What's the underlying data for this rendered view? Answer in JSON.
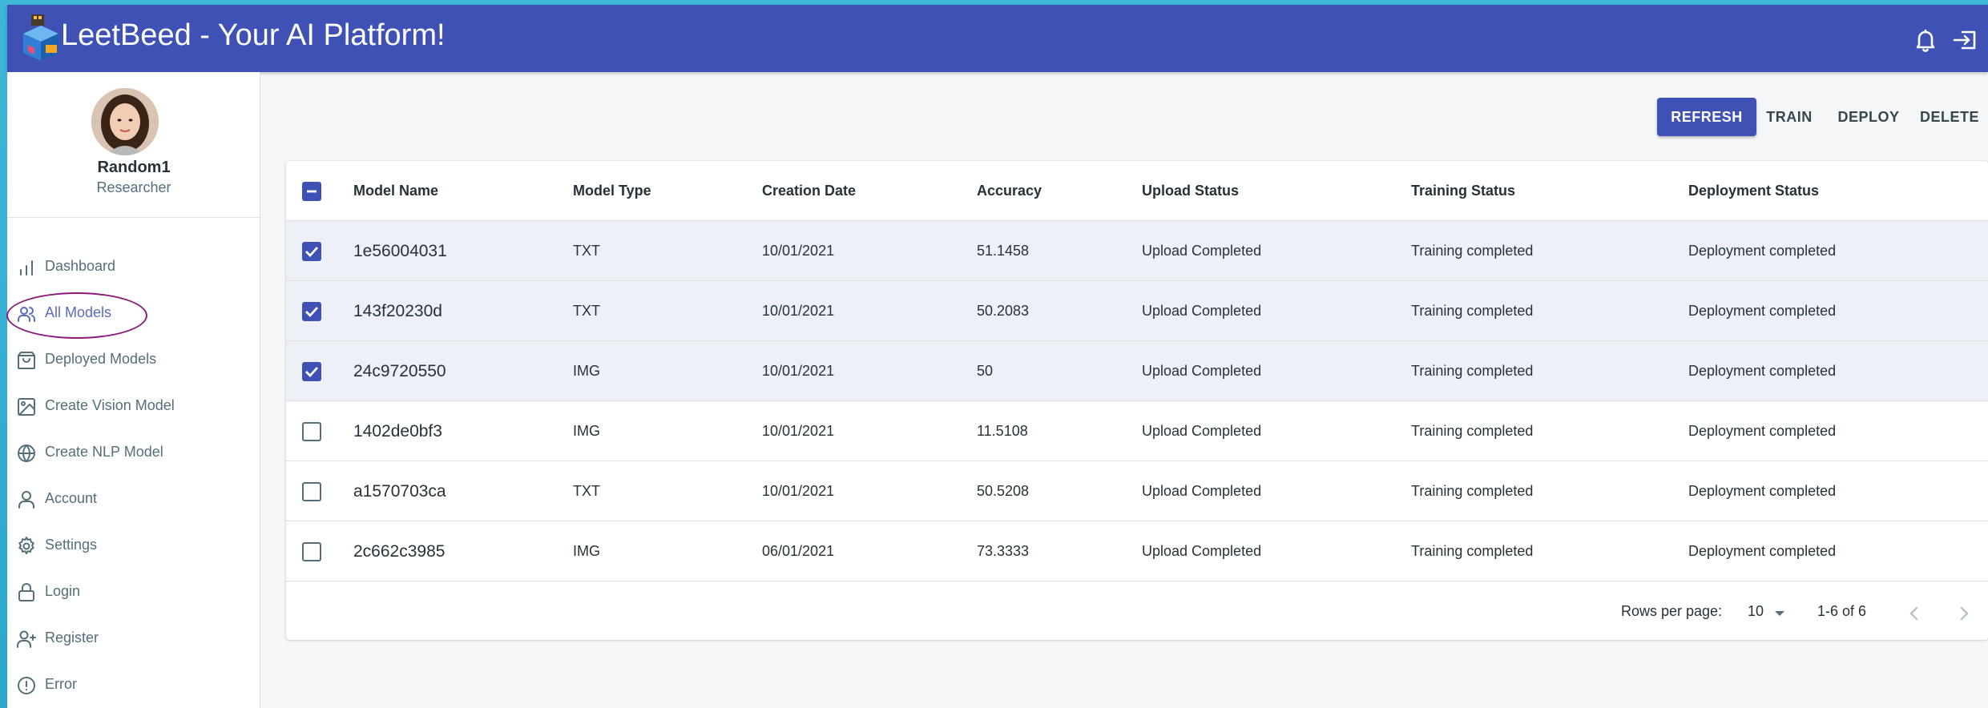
{
  "app": {
    "title": "LeetBeed - Your AI Platform!"
  },
  "profile": {
    "name": "Random1",
    "role": "Researcher"
  },
  "sidebar": {
    "items": [
      {
        "label": "Dashboard",
        "icon": "bar-chart-icon"
      },
      {
        "label": "All Models",
        "icon": "users-icon",
        "active": true
      },
      {
        "label": "Deployed Models",
        "icon": "shopping-bag-icon"
      },
      {
        "label": "Create Vision Model",
        "icon": "image-icon"
      },
      {
        "label": "Create NLP Model",
        "icon": "globe-icon"
      },
      {
        "label": "Account",
        "icon": "user-icon"
      },
      {
        "label": "Settings",
        "icon": "settings-icon"
      },
      {
        "label": "Login",
        "icon": "lock-icon"
      },
      {
        "label": "Register",
        "icon": "user-plus-icon"
      },
      {
        "label": "Error",
        "icon": "alert-circle-icon"
      }
    ]
  },
  "toolbar": {
    "refresh": "REFRESH",
    "train": "TRAIN",
    "deploy": "DEPLOY",
    "delete": "DELETE"
  },
  "table": {
    "columns": [
      "Model Name",
      "Model Type",
      "Creation Date",
      "Accuracy",
      "Upload Status",
      "Training Status",
      "Deployment Status"
    ],
    "rows": [
      {
        "selected": true,
        "name": "1e56004031",
        "type": "TXT",
        "date": "10/01/2021",
        "accuracy": "51.1458",
        "upload": "Upload Completed",
        "training": "Training completed",
        "deployment": "Deployment completed"
      },
      {
        "selected": true,
        "name": "143f20230d",
        "type": "TXT",
        "date": "10/01/2021",
        "accuracy": "50.2083",
        "upload": "Upload Completed",
        "training": "Training completed",
        "deployment": "Deployment completed"
      },
      {
        "selected": true,
        "name": "24c9720550",
        "type": "IMG",
        "date": "10/01/2021",
        "accuracy": "50",
        "upload": "Upload Completed",
        "training": "Training completed",
        "deployment": "Deployment completed"
      },
      {
        "selected": false,
        "name": "1402de0bf3",
        "type": "IMG",
        "date": "10/01/2021",
        "accuracy": "11.5108",
        "upload": "Upload Completed",
        "training": "Training completed",
        "deployment": "Deployment completed"
      },
      {
        "selected": false,
        "name": "a1570703ca",
        "type": "TXT",
        "date": "10/01/2021",
        "accuracy": "50.5208",
        "upload": "Upload Completed",
        "training": "Training completed",
        "deployment": "Deployment completed"
      },
      {
        "selected": false,
        "name": "2c662c3985",
        "type": "IMG",
        "date": "06/01/2021",
        "accuracy": "73.3333",
        "upload": "Upload Completed",
        "training": "Training completed",
        "deployment": "Deployment completed"
      }
    ]
  },
  "pagination": {
    "rows_per_page_label": "Rows per page:",
    "rows_per_page": "10",
    "range": "1-6 of 6"
  },
  "colors": {
    "primary": "#3f51b5",
    "annotation": "#8b1a7a"
  }
}
